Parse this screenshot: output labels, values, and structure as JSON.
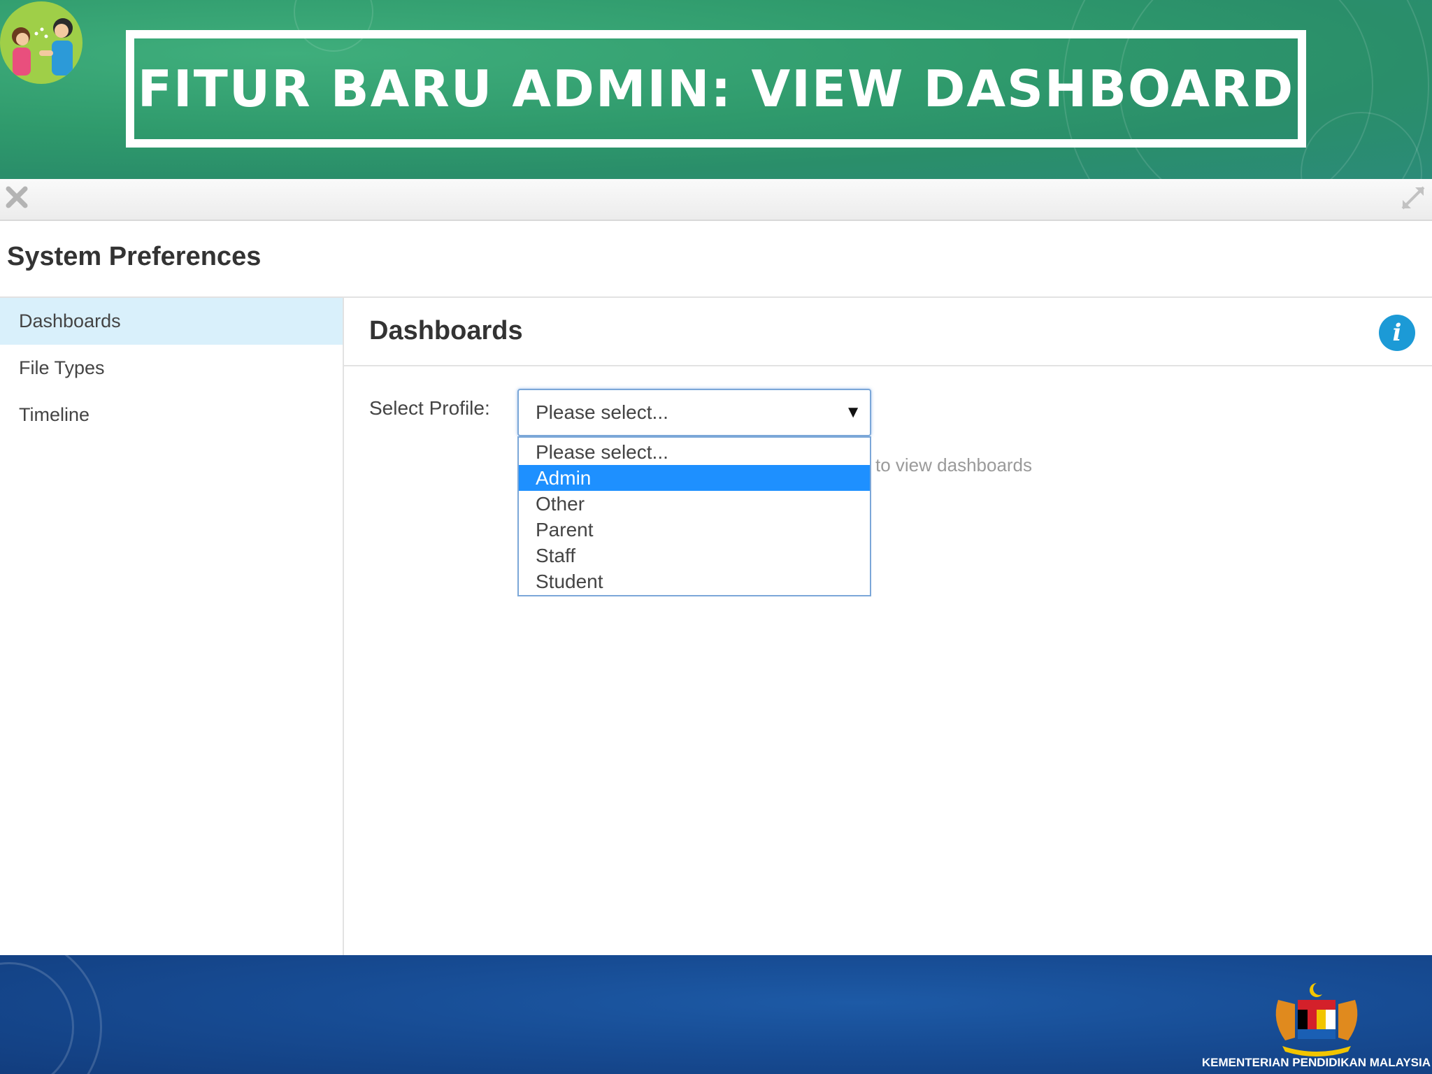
{
  "slide": {
    "title": "FITUR BARU ADMIN: VIEW DASHBOARD",
    "footer_text": "KEMENTERIAN PENDIDIKAN MALAYSIA"
  },
  "window": {
    "toolbar_icons": [
      "close-icon",
      "expand-icon"
    ]
  },
  "dialog": {
    "title": "System Preferences"
  },
  "sidebar": {
    "items": [
      {
        "label": "Dashboards",
        "active": true
      },
      {
        "label": "File Types",
        "active": false
      },
      {
        "label": "Timeline",
        "active": false
      }
    ]
  },
  "main": {
    "title": "Dashboards",
    "info_icon": "i",
    "select_label": "Select Profile:",
    "select_value": "Please select...",
    "options": [
      "Please select...",
      "Admin",
      "Other",
      "Parent",
      "Staff",
      "Student"
    ],
    "highlighted_option": "Admin",
    "hint_text": "to view dashboards"
  },
  "colors": {
    "banner_green": "#2f9a6c",
    "sidebar_active": "#d9f0fb",
    "option_highlight": "#1e90ff",
    "info_blue": "#1c9ad6",
    "footer_blue": "#174c94"
  }
}
